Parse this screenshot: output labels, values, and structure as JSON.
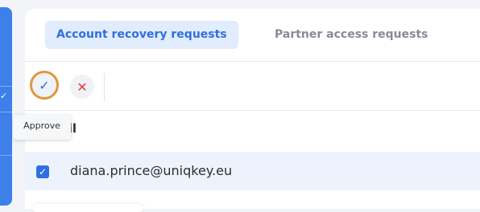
{
  "tabs": [
    {
      "label": "Account recovery requests",
      "active": true
    },
    {
      "label": "Partner access requests",
      "active": false
    }
  ],
  "toolbar": {
    "approve_icon": "✓",
    "reject_icon": "✕",
    "approve_tooltip": "Approve"
  },
  "table": {
    "column_header": "mail",
    "rows": [
      {
        "email": "diana.prince@uniqkey.eu",
        "selected": true
      }
    ]
  },
  "colors": {
    "accent": "#2f6fe0",
    "sidebar": "#3e80ea",
    "focus_ring": "#e2973a",
    "reject": "#e0413b"
  }
}
